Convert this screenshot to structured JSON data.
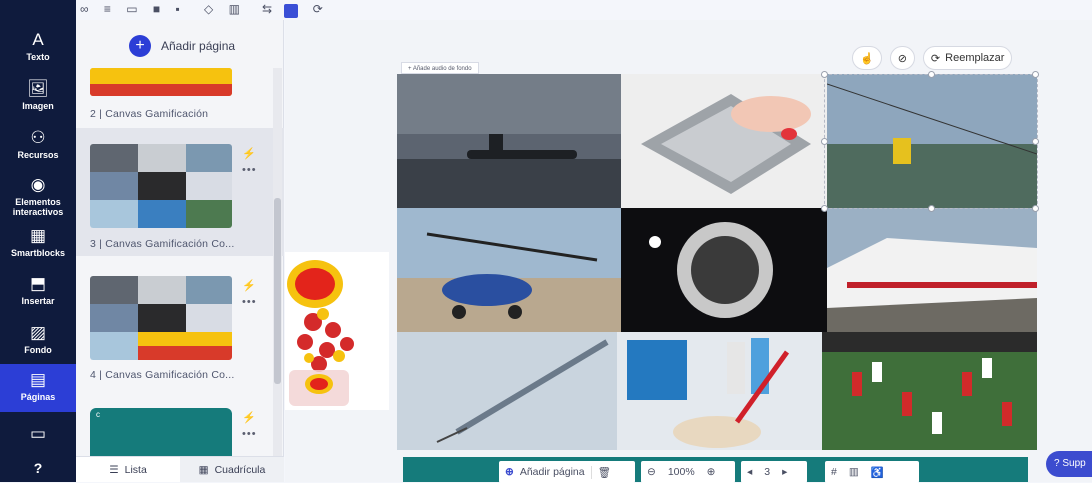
{
  "rail": {
    "items": [
      {
        "label": "Texto",
        "icon": "A"
      },
      {
        "label": "Imagen",
        "icon": "🖼"
      },
      {
        "label": "Recursos",
        "icon": "⚇"
      },
      {
        "label": "Elementos interactivos",
        "icon": "◉"
      },
      {
        "label": "Smartblocks",
        "icon": "▦"
      },
      {
        "label": "Insertar",
        "icon": "⬒"
      },
      {
        "label": "Fondo",
        "icon": "▨"
      },
      {
        "label": "Páginas",
        "icon": "▤"
      },
      {
        "label": "",
        "icon": "▭"
      },
      {
        "label": "",
        "icon": "?"
      }
    ],
    "active_index": 7
  },
  "panel": {
    "add_page": "Añadir página",
    "pages": [
      {
        "label": "2 | Canvas Gamificación"
      },
      {
        "label": "3 | Canvas Gamificación Co..."
      },
      {
        "label": "4 | Canvas Gamificación Co..."
      }
    ],
    "view_tabs": {
      "list": "Lista",
      "grid": "Cuadrícula"
    }
  },
  "canvas": {
    "audio_chip": "Añade audio de fondo",
    "replace_label": "Reemplazar"
  },
  "bottombar": {
    "add_page": "Añadir página",
    "zoom": "100%",
    "page_number": "3"
  },
  "support": "Supp",
  "colors": {
    "rail": "#0f1b3d",
    "accent": "#2c3ed6",
    "toolbar": "#157b7b"
  }
}
